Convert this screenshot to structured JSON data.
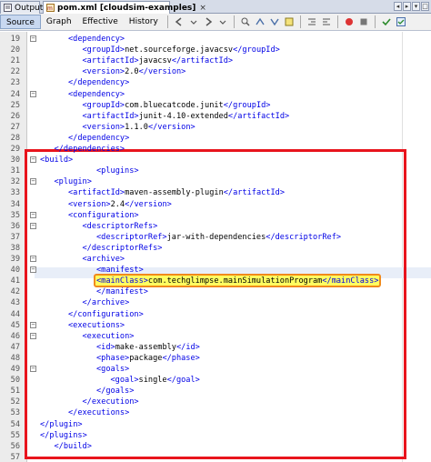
{
  "tabs": [
    {
      "label": "Output",
      "active": false
    },
    {
      "label": "pom.xml [cloudsim-examples]",
      "active": true
    }
  ],
  "toolbar": {
    "source_label": "Source",
    "graph_label": "Graph",
    "effective_label": "Effective",
    "history_label": "History"
  },
  "lines": [
    {
      "n": "19",
      "indent": 2,
      "parts": [
        [
          "tag",
          "<dependency>"
        ]
      ]
    },
    {
      "n": "20",
      "indent": 3,
      "parts": [
        [
          "tag",
          "<groupId>"
        ],
        [
          "txt",
          "net.sourceforge.javacsv"
        ],
        [
          "tag",
          "</groupId>"
        ]
      ]
    },
    {
      "n": "21",
      "indent": 3,
      "parts": [
        [
          "tag",
          "<artifactId>"
        ],
        [
          "txt",
          "javacsv"
        ],
        [
          "tag",
          "</artifactId>"
        ]
      ]
    },
    {
      "n": "22",
      "indent": 3,
      "parts": [
        [
          "tag",
          "<version>"
        ],
        [
          "txt",
          "2.0"
        ],
        [
          "tag",
          "</version>"
        ]
      ]
    },
    {
      "n": "23",
      "indent": 2,
      "parts": [
        [
          "tag",
          "</dependency>"
        ]
      ]
    },
    {
      "n": "24",
      "indent": 2,
      "parts": [
        [
          "tag",
          "<dependency>"
        ]
      ]
    },
    {
      "n": "25",
      "indent": 3,
      "parts": [
        [
          "tag",
          "<groupId>"
        ],
        [
          "txt",
          "com.bluecatcode.junit"
        ],
        [
          "tag",
          "</groupId>"
        ]
      ]
    },
    {
      "n": "26",
      "indent": 3,
      "parts": [
        [
          "tag",
          "<artifactId>"
        ],
        [
          "txt",
          "junit-4.10-extended"
        ],
        [
          "tag",
          "</artifactId>"
        ]
      ]
    },
    {
      "n": "27",
      "indent": 3,
      "parts": [
        [
          "tag",
          "<version>"
        ],
        [
          "txt",
          "1.1.0"
        ],
        [
          "tag",
          "</version>"
        ]
      ]
    },
    {
      "n": "28",
      "indent": 2,
      "parts": [
        [
          "tag",
          "</dependency>"
        ]
      ]
    },
    {
      "n": "29",
      "indent": 1,
      "parts": [
        [
          "tag",
          "</dependencies>"
        ]
      ]
    },
    {
      "n": "30",
      "indent": 0,
      "parts": [
        [
          "tag",
          "<build>"
        ]
      ]
    },
    {
      "n": "31",
      "indent": 4,
      "parts": [
        [
          "tag",
          "<plugins>"
        ]
      ]
    },
    {
      "n": "32",
      "indent": 1,
      "parts": [
        [
          "tag",
          "<plugin>"
        ]
      ]
    },
    {
      "n": "33",
      "indent": 2,
      "parts": [
        [
          "tag",
          "<artifactId>"
        ],
        [
          "txt",
          "maven-assembly-plugin"
        ],
        [
          "tag",
          "</artifactId>"
        ]
      ]
    },
    {
      "n": "34",
      "indent": 2,
      "parts": [
        [
          "tag",
          "<version>"
        ],
        [
          "txt",
          "2.4"
        ],
        [
          "tag",
          "</version>"
        ]
      ]
    },
    {
      "n": "35",
      "indent": 2,
      "parts": [
        [
          "tag",
          "<configuration>"
        ]
      ]
    },
    {
      "n": "36",
      "indent": 3,
      "parts": [
        [
          "tag",
          "<descriptorRefs>"
        ]
      ]
    },
    {
      "n": "37",
      "indent": 4,
      "parts": [
        [
          "tag",
          "<descriptorRef>"
        ],
        [
          "txt",
          "jar-with-dependencies"
        ],
        [
          "tag",
          "</descriptorRef>"
        ]
      ]
    },
    {
      "n": "38",
      "indent": 3,
      "parts": [
        [
          "tag",
          "</descriptorRefs>"
        ]
      ]
    },
    {
      "n": "39",
      "indent": 3,
      "parts": [
        [
          "tag",
          "<archive>"
        ]
      ]
    },
    {
      "n": "40",
      "indent": 4,
      "parts": [
        [
          "tag",
          "<manifest>"
        ]
      ]
    },
    {
      "n": "41",
      "indent": 4,
      "parts": [
        [
          "tag",
          "<mainClass>"
        ],
        [
          "txt",
          "com.techglimpse.mainSimulationProgram"
        ],
        [
          "tag",
          "</mainClass>"
        ]
      ]
    },
    {
      "n": "42",
      "indent": 4,
      "parts": [
        [
          "tag",
          "</manifest>"
        ]
      ]
    },
    {
      "n": "43",
      "indent": 3,
      "parts": [
        [
          "tag",
          "</archive>"
        ]
      ]
    },
    {
      "n": "44",
      "indent": 2,
      "parts": [
        [
          "tag",
          "</configuration>"
        ]
      ]
    },
    {
      "n": "45",
      "indent": 2,
      "parts": [
        [
          "tag",
          "<executions>"
        ]
      ]
    },
    {
      "n": "46",
      "indent": 3,
      "parts": [
        [
          "tag",
          "<execution>"
        ]
      ]
    },
    {
      "n": "47",
      "indent": 4,
      "parts": [
        [
          "tag",
          "<id>"
        ],
        [
          "txt",
          "make-assembly"
        ],
        [
          "tag",
          "</id>"
        ]
      ]
    },
    {
      "n": "48",
      "indent": 4,
      "parts": [
        [
          "tag",
          "<phase>"
        ],
        [
          "txt",
          "package"
        ],
        [
          "tag",
          "</phase>"
        ]
      ]
    },
    {
      "n": "49",
      "indent": 4,
      "parts": [
        [
          "tag",
          "<goals>"
        ]
      ]
    },
    {
      "n": "50",
      "indent": 5,
      "parts": [
        [
          "tag",
          "<goal>"
        ],
        [
          "txt",
          "single"
        ],
        [
          "tag",
          "</goal>"
        ]
      ]
    },
    {
      "n": "51",
      "indent": 4,
      "parts": [
        [
          "tag",
          "</goals>"
        ]
      ]
    },
    {
      "n": "52",
      "indent": 3,
      "parts": [
        [
          "tag",
          "</execution>"
        ]
      ]
    },
    {
      "n": "53",
      "indent": 2,
      "parts": [
        [
          "tag",
          "</executions>"
        ]
      ]
    },
    {
      "n": "54",
      "indent": 0,
      "parts": [
        [
          "tag",
          "</plugin>"
        ]
      ]
    },
    {
      "n": "55",
      "indent": 0,
      "parts": [
        [
          "tag",
          "</plugins>"
        ]
      ]
    },
    {
      "n": "56",
      "indent": 1,
      "parts": [
        [
          "tag",
          "</build>"
        ]
      ]
    },
    {
      "n": "57",
      "indent": 0,
      "parts": []
    },
    {
      "n": "58",
      "indent": 0,
      "parts": [
        [
          "tag",
          "</project>"
        ]
      ]
    },
    {
      "n": "59",
      "indent": 0,
      "parts": []
    }
  ],
  "colors": {
    "annotation_box": "#e8141d",
    "highlight_border": "#f08a1c",
    "highlight_fill": "#ffff60",
    "tag_color": "#0000e6"
  }
}
